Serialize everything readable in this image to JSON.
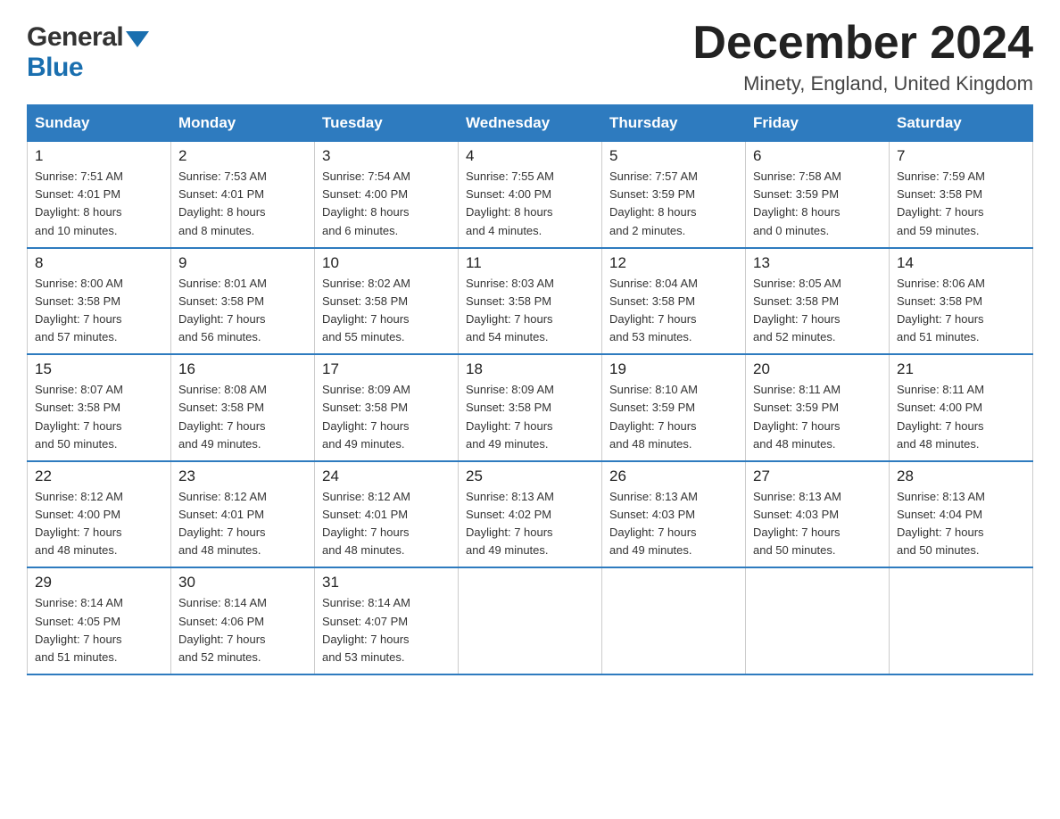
{
  "header": {
    "logo_general": "General",
    "logo_blue": "Blue",
    "month_title": "December 2024",
    "location": "Minety, England, United Kingdom"
  },
  "days_of_week": [
    "Sunday",
    "Monday",
    "Tuesday",
    "Wednesday",
    "Thursday",
    "Friday",
    "Saturday"
  ],
  "weeks": [
    [
      {
        "day": "1",
        "sunrise": "7:51 AM",
        "sunset": "4:01 PM",
        "daylight": "8 hours and 10 minutes."
      },
      {
        "day": "2",
        "sunrise": "7:53 AM",
        "sunset": "4:01 PM",
        "daylight": "8 hours and 8 minutes."
      },
      {
        "day": "3",
        "sunrise": "7:54 AM",
        "sunset": "4:00 PM",
        "daylight": "8 hours and 6 minutes."
      },
      {
        "day": "4",
        "sunrise": "7:55 AM",
        "sunset": "4:00 PM",
        "daylight": "8 hours and 4 minutes."
      },
      {
        "day": "5",
        "sunrise": "7:57 AM",
        "sunset": "3:59 PM",
        "daylight": "8 hours and 2 minutes."
      },
      {
        "day": "6",
        "sunrise": "7:58 AM",
        "sunset": "3:59 PM",
        "daylight": "8 hours and 0 minutes."
      },
      {
        "day": "7",
        "sunrise": "7:59 AM",
        "sunset": "3:58 PM",
        "daylight": "7 hours and 59 minutes."
      }
    ],
    [
      {
        "day": "8",
        "sunrise": "8:00 AM",
        "sunset": "3:58 PM",
        "daylight": "7 hours and 57 minutes."
      },
      {
        "day": "9",
        "sunrise": "8:01 AM",
        "sunset": "3:58 PM",
        "daylight": "7 hours and 56 minutes."
      },
      {
        "day": "10",
        "sunrise": "8:02 AM",
        "sunset": "3:58 PM",
        "daylight": "7 hours and 55 minutes."
      },
      {
        "day": "11",
        "sunrise": "8:03 AM",
        "sunset": "3:58 PM",
        "daylight": "7 hours and 54 minutes."
      },
      {
        "day": "12",
        "sunrise": "8:04 AM",
        "sunset": "3:58 PM",
        "daylight": "7 hours and 53 minutes."
      },
      {
        "day": "13",
        "sunrise": "8:05 AM",
        "sunset": "3:58 PM",
        "daylight": "7 hours and 52 minutes."
      },
      {
        "day": "14",
        "sunrise": "8:06 AM",
        "sunset": "3:58 PM",
        "daylight": "7 hours and 51 minutes."
      }
    ],
    [
      {
        "day": "15",
        "sunrise": "8:07 AM",
        "sunset": "3:58 PM",
        "daylight": "7 hours and 50 minutes."
      },
      {
        "day": "16",
        "sunrise": "8:08 AM",
        "sunset": "3:58 PM",
        "daylight": "7 hours and 49 minutes."
      },
      {
        "day": "17",
        "sunrise": "8:09 AM",
        "sunset": "3:58 PM",
        "daylight": "7 hours and 49 minutes."
      },
      {
        "day": "18",
        "sunrise": "8:09 AM",
        "sunset": "3:58 PM",
        "daylight": "7 hours and 49 minutes."
      },
      {
        "day": "19",
        "sunrise": "8:10 AM",
        "sunset": "3:59 PM",
        "daylight": "7 hours and 48 minutes."
      },
      {
        "day": "20",
        "sunrise": "8:11 AM",
        "sunset": "3:59 PM",
        "daylight": "7 hours and 48 minutes."
      },
      {
        "day": "21",
        "sunrise": "8:11 AM",
        "sunset": "4:00 PM",
        "daylight": "7 hours and 48 minutes."
      }
    ],
    [
      {
        "day": "22",
        "sunrise": "8:12 AM",
        "sunset": "4:00 PM",
        "daylight": "7 hours and 48 minutes."
      },
      {
        "day": "23",
        "sunrise": "8:12 AM",
        "sunset": "4:01 PM",
        "daylight": "7 hours and 48 minutes."
      },
      {
        "day": "24",
        "sunrise": "8:12 AM",
        "sunset": "4:01 PM",
        "daylight": "7 hours and 48 minutes."
      },
      {
        "day": "25",
        "sunrise": "8:13 AM",
        "sunset": "4:02 PM",
        "daylight": "7 hours and 49 minutes."
      },
      {
        "day": "26",
        "sunrise": "8:13 AM",
        "sunset": "4:03 PM",
        "daylight": "7 hours and 49 minutes."
      },
      {
        "day": "27",
        "sunrise": "8:13 AM",
        "sunset": "4:03 PM",
        "daylight": "7 hours and 50 minutes."
      },
      {
        "day": "28",
        "sunrise": "8:13 AM",
        "sunset": "4:04 PM",
        "daylight": "7 hours and 50 minutes."
      }
    ],
    [
      {
        "day": "29",
        "sunrise": "8:14 AM",
        "sunset": "4:05 PM",
        "daylight": "7 hours and 51 minutes."
      },
      {
        "day": "30",
        "sunrise": "8:14 AM",
        "sunset": "4:06 PM",
        "daylight": "7 hours and 52 minutes."
      },
      {
        "day": "31",
        "sunrise": "8:14 AM",
        "sunset": "4:07 PM",
        "daylight": "7 hours and 53 minutes."
      },
      null,
      null,
      null,
      null
    ]
  ],
  "labels": {
    "sunrise": "Sunrise:",
    "sunset": "Sunset:",
    "daylight": "Daylight:"
  }
}
